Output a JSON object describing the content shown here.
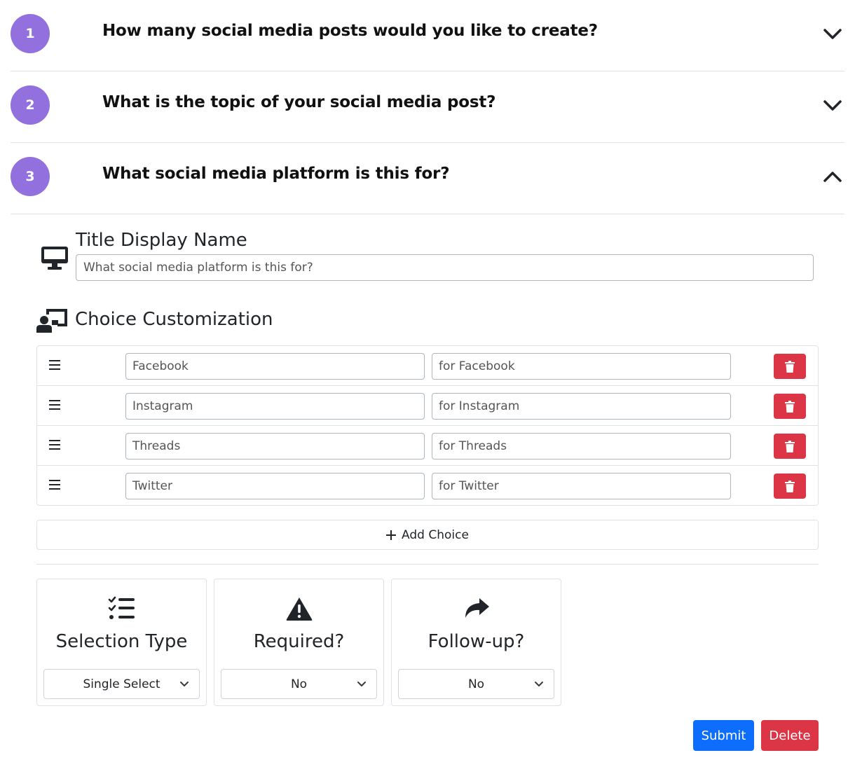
{
  "questions": [
    {
      "number": "1",
      "text": "How many social media posts would you like to create?",
      "expanded": false
    },
    {
      "number": "2",
      "text": "What is the topic of your social media post?",
      "expanded": false
    },
    {
      "number": "3",
      "text": "What social media platform is this for?",
      "expanded": true
    }
  ],
  "editor": {
    "title_label": "Title Display Name",
    "title_value": "What social media platform is this for?",
    "choice_section_label": "Choice Customization",
    "choices": [
      {
        "name": "Facebook",
        "description": "for Facebook"
      },
      {
        "name": "Instagram",
        "description": "for Instagram"
      },
      {
        "name": "Threads",
        "description": "for Threads"
      },
      {
        "name": "Twitter",
        "description": "for Twitter"
      }
    ],
    "add_choice_label": "Add Choice",
    "settings": [
      {
        "title": "Selection Type",
        "value": "Single Select",
        "icon": "list-check-icon"
      },
      {
        "title": "Required?",
        "value": "No",
        "icon": "warning-icon"
      },
      {
        "title": "Follow-up?",
        "value": "No",
        "icon": "share-arrow-icon"
      }
    ],
    "submit_label": "Submit",
    "delete_label": "Delete"
  },
  "colors": {
    "badge": "#9270dd",
    "danger": "#dc3545",
    "primary": "#0d6efd"
  }
}
